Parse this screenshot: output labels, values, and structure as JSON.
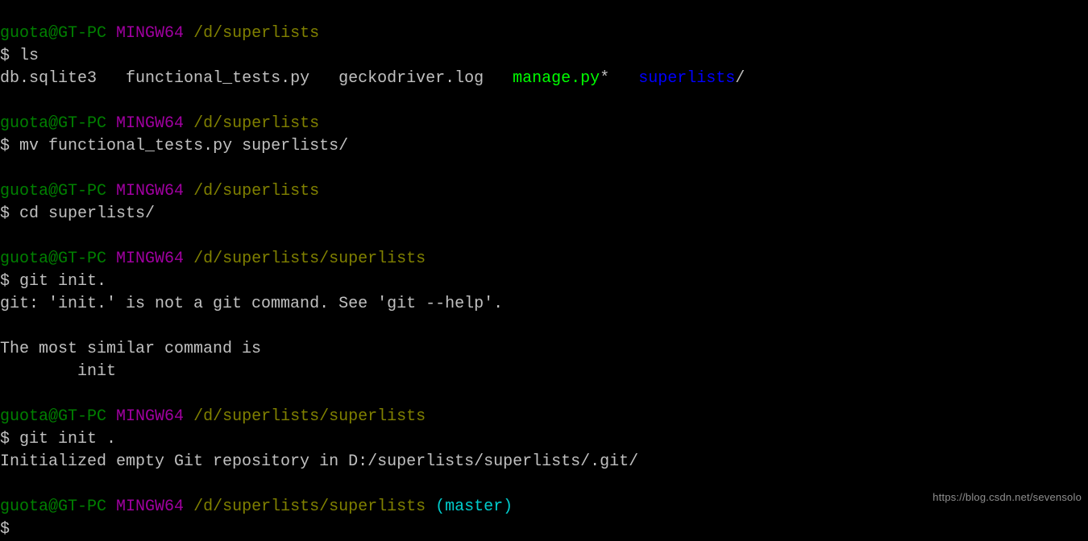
{
  "prompt": {
    "user": "guota@GT-PC",
    "shell": "MINGW64",
    "path1": "/d/superlists",
    "path2": "/d/superlists/superlists",
    "branch": "(master)",
    "sigil": "$"
  },
  "cmd": {
    "ls": "ls",
    "mv": "mv functional_tests.py superlists/",
    "cd": "cd superlists/",
    "gitinit_bad": "git init.",
    "gitinit_good": "git init .",
    "empty": ""
  },
  "ls_out": {
    "a": "db.sqlite3",
    "b": "functional_tests.py",
    "c": "geckodriver.log",
    "d": "manage.py",
    "d_star": "*",
    "e": "superlists",
    "e_slash": "/"
  },
  "git_err": {
    "l1": "git: 'init.' is not a git command. See 'git --help'.",
    "l2": "",
    "l3": "The most similar command is",
    "l4": "        init"
  },
  "git_ok": "Initialized empty Git repository in D:/superlists/superlists/.git/",
  "watermark": "https://blog.csdn.net/sevensolo"
}
